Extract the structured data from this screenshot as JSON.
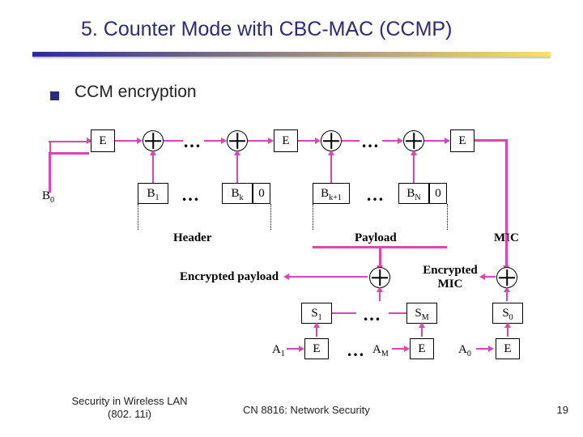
{
  "title": "5. Counter Mode with CBC-MAC (CCMP)",
  "bullet": "CCM encryption",
  "E": "E",
  "zero": "0",
  "ell1": "…",
  "ell2": "…",
  "ell3": "…",
  "ell4": "…",
  "ell5": "…",
  "ell6": "…",
  "B0": "B",
  "B0s": "0",
  "B1": "B",
  "B1s": "1",
  "Bk": "B",
  "Bks": "k",
  "Bk1": "B",
  "Bk1s": "k+1",
  "BN": "B",
  "BNs": "N",
  "header": "Header",
  "payload": "Payload",
  "mic": "MIC",
  "encpay": "Encrypted payload",
  "encmic_l1": "Encrypted",
  "encmic_l2": "MIC",
  "S1": "S",
  "S1s": "1",
  "SM": "S",
  "SMs": "M",
  "S0": "S",
  "S0s": "0",
  "A1": "A",
  "A1s": "1",
  "AM": "A",
  "AMs": "M",
  "A0": "A",
  "A0s": "0",
  "footer_left_l1": "Security in Wireless LAN",
  "footer_left_l2": "(802. 11i)",
  "footer_mid": "CN 8816: Network Security",
  "footer_right": "19",
  "chart_data": {
    "type": "diagram",
    "top_chain": {
      "nodes": [
        "B0",
        "E",
        "⊕",
        "…",
        "⊕",
        "E",
        "⊕",
        "…",
        "⊕",
        "E"
      ],
      "inputs_below": [
        "B1",
        "…",
        "Bk",
        "0",
        "Bk+1",
        "…",
        "BN",
        "0"
      ]
    },
    "spans": [
      {
        "label": "Header",
        "covers": [
          "B1",
          "…",
          "Bk"
        ]
      },
      {
        "label": "Payload",
        "covers": [
          "Bk+1",
          "…",
          "BN"
        ]
      },
      {
        "label": "MIC",
        "covers": [
          "output of final E"
        ]
      }
    ],
    "lower_section": {
      "encrypted_payload_xor": {
        "inputs": [
          "Payload",
          "S1…SM"
        ],
        "output": "Encrypted payload"
      },
      "encrypted_mic_xor": {
        "inputs": [
          "MIC",
          "S0"
        ],
        "output": "Encrypted MIC"
      },
      "S_generation": [
        {
          "S": "S1",
          "from": "E(A1)"
        },
        {
          "S": "SM",
          "from": "E(AM)"
        },
        {
          "S": "S0",
          "from": "E(A0)"
        }
      ]
    }
  }
}
